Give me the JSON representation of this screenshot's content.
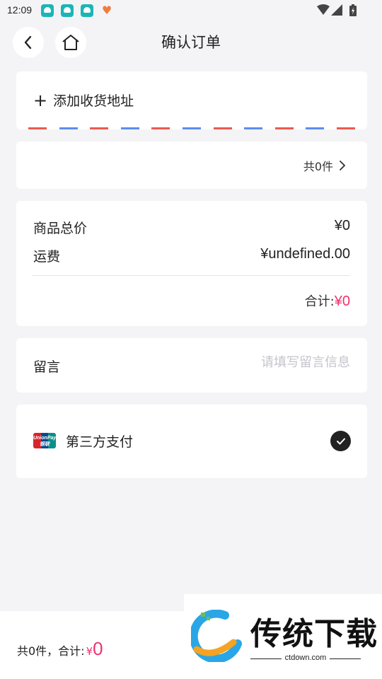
{
  "status": {
    "time": "12:09"
  },
  "nav": {
    "title": "确认订单"
  },
  "address": {
    "add_label": "添加收货地址",
    "stripe_colors": [
      "#ee5a4f",
      "#5b8ef2"
    ]
  },
  "items": {
    "count_label": "共0件"
  },
  "summary": {
    "goods_label": "商品总价",
    "goods_value": "¥0",
    "shipping_label": "运费",
    "shipping_value": "¥undefined.00",
    "total_label": "合计:",
    "total_value": "¥0"
  },
  "message": {
    "label": "留言",
    "placeholder": "请填写留言信息"
  },
  "payment": {
    "logo_text": "UnionPay 银联",
    "method_label": "第三方支付",
    "selected": true
  },
  "bottom": {
    "summary_label": "共0件，合计:",
    "currency": "¥",
    "amount": "0"
  },
  "watermark": {
    "brand": "传统下载",
    "url": "ctdown.com"
  },
  "colors": {
    "accent": "#f0326e",
    "bg": "#f4f4f6"
  }
}
